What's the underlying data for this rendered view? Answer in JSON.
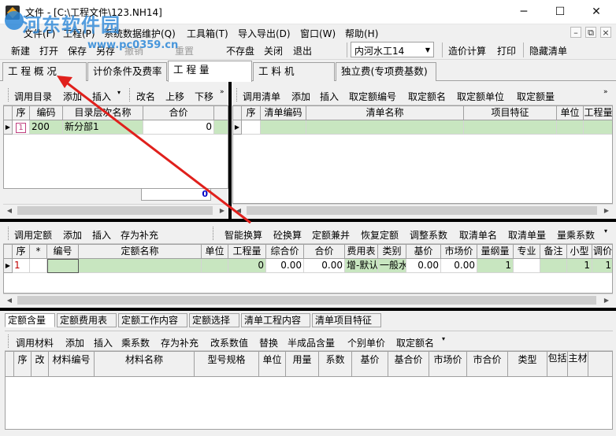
{
  "window": {
    "title": "文件 - [C:\\工程文件\\123.NH14]",
    "minimize": "─",
    "maximize": "☐",
    "close": "✕"
  },
  "watermark": {
    "text": "河东软件园",
    "url": "www.pc0359.cn"
  },
  "menu": [
    "文件(F)",
    "工程(P)",
    "系统数据维护(Q)",
    "工具箱(T)",
    "导入导出(D)",
    "窗口(W)",
    "帮助(H)"
  ],
  "mdi_controls": [
    "–",
    "⧉",
    "×"
  ],
  "toolbar": {
    "buttons": [
      "新建",
      "打开",
      "保存",
      "另存",
      "撤销",
      "重置",
      "不存盘",
      "关闭",
      "退出"
    ],
    "combo_value": "内河水工14",
    "buttons2": [
      "造价计算",
      "打印",
      "隐藏清单"
    ]
  },
  "main_tabs": [
    "工 程 概 况",
    "计价条件及费率",
    "工 程 量",
    "工 料 机",
    "独立费(专项费基数)"
  ],
  "left_panel": {
    "toolbar": [
      "调用目录",
      "添加",
      "插入",
      "改名",
      "上移",
      "下移"
    ],
    "headers": [
      "序",
      "编码",
      "目录层次名称",
      "合价"
    ],
    "rows": [
      {
        "seq": "1",
        "code": "200",
        "name": "新分部1",
        "total": "0"
      }
    ],
    "total_value": "0"
  },
  "right_panel": {
    "toolbar": [
      "调用清单",
      "添加",
      "插入",
      "取定额编号",
      "取定额名",
      "取定额单位",
      "取定额量"
    ],
    "headers": [
      "序",
      "清单编码",
      "清单名称",
      "项目特征",
      "单位",
      "工程量"
    ]
  },
  "quota_panel": {
    "toolbar": [
      "调用定额",
      "添加",
      "插入",
      "存为补充"
    ],
    "toolbar2": [
      "智能换算",
      "砼换算",
      "定额兼并",
      "恢复定额",
      "调整系数",
      "取清单名",
      "取清单量",
      "量乘系数"
    ],
    "headers": [
      "序",
      "*",
      "编号",
      "定额名称",
      "单位",
      "工程量",
      "综合价",
      "合价",
      "费用表",
      "类别",
      "基价",
      "市场价",
      "量纲量",
      "专业",
      "备注",
      "小型",
      "调价"
    ],
    "rows": [
      {
        "seq": "1",
        "star": "",
        "code": "",
        "name": "",
        "unit": "",
        "qty": "0",
        "comp_price": "0.00",
        "total": "0.00",
        "fee_table": "增-默认",
        "category": "一般水",
        "base": "0.00",
        "market": "0.00",
        "dim_qty": "1",
        "spec": "",
        "note": "",
        "small": "1",
        "adj": "1"
      }
    ]
  },
  "bottom_tabs": [
    "定额含量",
    "定额费用表",
    "定额工作内容",
    "定额选择",
    "清单工程内容",
    "清单项目特征"
  ],
  "material_panel": {
    "toolbar": [
      "调用材料",
      "添加",
      "插入",
      "乘系数",
      "存为补充",
      "改系数值",
      "替换",
      "半成品含量",
      "个别单价",
      "取定额名"
    ],
    "headers": [
      "序",
      "改",
      "材料编号",
      "材料名称",
      "型号规格",
      "单位",
      "用量",
      "系数",
      "基价",
      "基合价",
      "市场价",
      "市合价",
      "类型",
      "包括",
      "主材"
    ]
  },
  "colors": {
    "row_green": "#c8e6c0",
    "arrow_red": "#e0201c",
    "watermark_blue": "#2b87d8"
  }
}
